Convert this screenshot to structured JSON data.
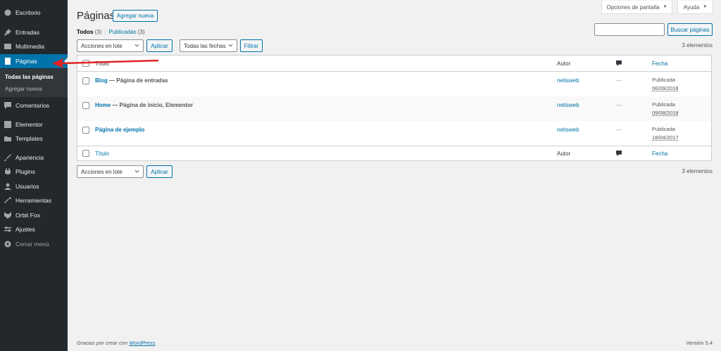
{
  "sidebar": {
    "items": [
      {
        "label": "Escritorio",
        "icon": "dashboard-icon"
      },
      {
        "label": "Entradas",
        "icon": "pin-icon"
      },
      {
        "label": "Multimedia",
        "icon": "media-icon"
      },
      {
        "label": "Páginas",
        "icon": "page-icon"
      },
      {
        "label": "Comentarios",
        "icon": "comment-icon"
      },
      {
        "label": "Elementor",
        "icon": "elementor-icon"
      },
      {
        "label": "Templates",
        "icon": "folder-icon"
      },
      {
        "label": "Apariencia",
        "icon": "brush-icon"
      },
      {
        "label": "Plugins",
        "icon": "plugin-icon"
      },
      {
        "label": "Usuarios",
        "icon": "user-icon"
      },
      {
        "label": "Herramientas",
        "icon": "wrench-icon"
      },
      {
        "label": "Orbit Fox",
        "icon": "fox-icon"
      },
      {
        "label": "Ajustes",
        "icon": "settings-icon"
      },
      {
        "label": "Cerrar menú",
        "icon": "collapse-icon"
      }
    ],
    "submenu": [
      "Todas las páginas",
      "Agregar nueva"
    ]
  },
  "header": {
    "screen_options": "Opciones de pantalla",
    "help": "Ayuda",
    "title": "Páginas",
    "add_new": "Agregar nueva"
  },
  "filters": {
    "all_label": "Todos",
    "all_count": "(3)",
    "separator": "|",
    "published_label": "Publicadas",
    "published_count": "(3)",
    "bulk_actions": "Acciones en lote",
    "apply": "Aplicar",
    "all_dates": "Todas las fechas",
    "filter": "Filtrar",
    "search_button": "Buscar páginas",
    "items_count": "3 elementos"
  },
  "table": {
    "columns": {
      "title": "Título",
      "author": "Autor",
      "date": "Fecha"
    },
    "rows": [
      {
        "title": "Blog",
        "state": " — Página de entradas",
        "author": "netisweb",
        "comments": "—",
        "status": "Publicada",
        "date": "06/09/2018"
      },
      {
        "title": "Home",
        "state": " — Página de inicio, Elementor",
        "author": "netisweb",
        "comments": "—",
        "status": "Publicada",
        "date": "09/08/2018"
      },
      {
        "title": "Página de ejemplo",
        "state": "",
        "author": "netisweb",
        "comments": "—",
        "status": "Publicada",
        "date": "18/04/2017"
      }
    ]
  },
  "footer": {
    "thanks_prefix": "Gracias por crear con ",
    "thanks_link": "WordPress",
    "thanks_suffix": ".",
    "version": "Versión 5.4"
  },
  "colors": {
    "accent": "#0073aa",
    "sidebar": "#23282d",
    "annotation": "#e02424"
  }
}
